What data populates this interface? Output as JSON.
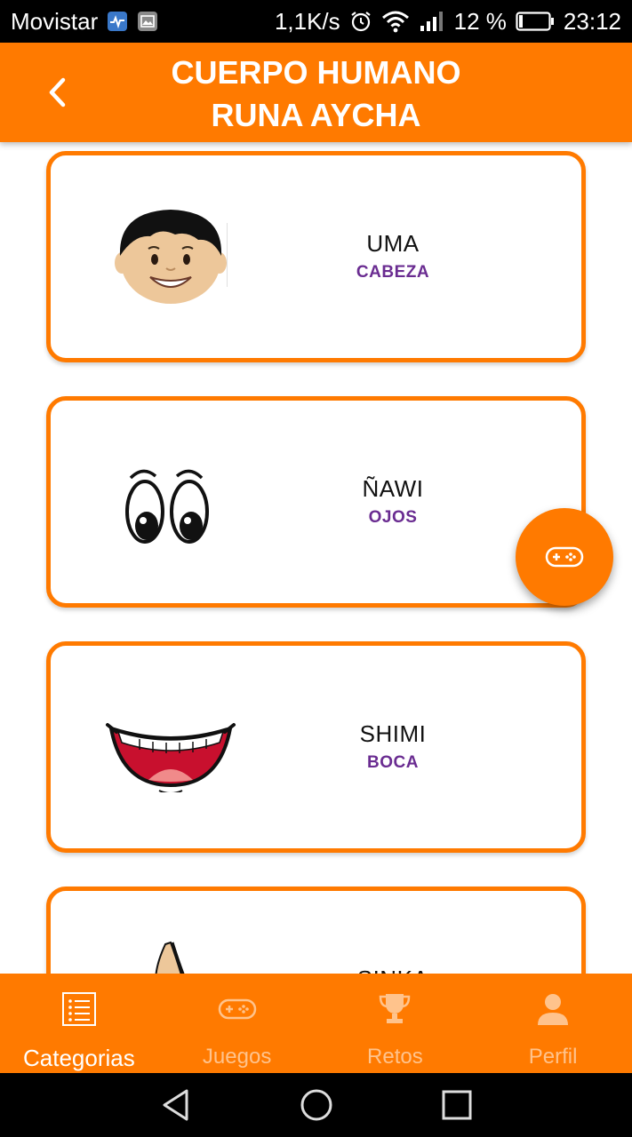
{
  "status_bar": {
    "carrier": "Movistar",
    "speed": "1,1K/s",
    "battery": "12 %",
    "time": "23:12"
  },
  "header": {
    "title_line1": "CUERPO HUMANO",
    "title_line2": "RUNA AYCHA"
  },
  "cards": [
    {
      "title": "UMA",
      "subtitle": "CABEZA",
      "icon": "head-face-icon"
    },
    {
      "title": "ÑAWI",
      "subtitle": "OJOS",
      "icon": "eyes-icon"
    },
    {
      "title": "SHIMI",
      "subtitle": "BOCA",
      "icon": "mouth-icon"
    },
    {
      "title": "SINKA",
      "subtitle": "",
      "icon": "nose-icon"
    }
  ],
  "fab": {
    "icon": "gamepad-icon"
  },
  "bottom_nav": {
    "items": [
      {
        "label": "Categorias",
        "icon": "list-icon",
        "active": true
      },
      {
        "label": "Juegos",
        "icon": "gamepad-icon",
        "active": false
      },
      {
        "label": "Retos",
        "icon": "trophy-icon",
        "active": false
      },
      {
        "label": "Perfil",
        "icon": "person-icon",
        "active": false
      }
    ]
  },
  "colors": {
    "primary": "#FF7A00",
    "subtitle": "#6A2C91",
    "background": "#FFFFFF"
  }
}
